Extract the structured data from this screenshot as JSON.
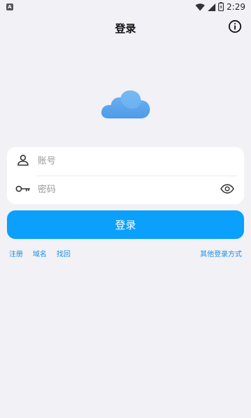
{
  "status_bar": {
    "notification_letter": "A",
    "time": "2:29"
  },
  "header": {
    "title": "登录"
  },
  "form": {
    "account_placeholder": "账号",
    "account_value": "",
    "password_placeholder": "密码",
    "password_value": ""
  },
  "login_button_label": "登录",
  "links": {
    "register": "注册",
    "domain": "域名",
    "recover": "找回",
    "other_methods": "其他登录方式"
  },
  "colors": {
    "accent": "#0aa0fb",
    "link": "#1a8fe0",
    "background": "#f2f1f6",
    "cloud": "#5ba6ef"
  },
  "icons": {
    "info": "info-circle-icon",
    "account": "person-icon",
    "password": "key-icon",
    "visibility": "eye-icon",
    "logo": "cloud-icon"
  }
}
